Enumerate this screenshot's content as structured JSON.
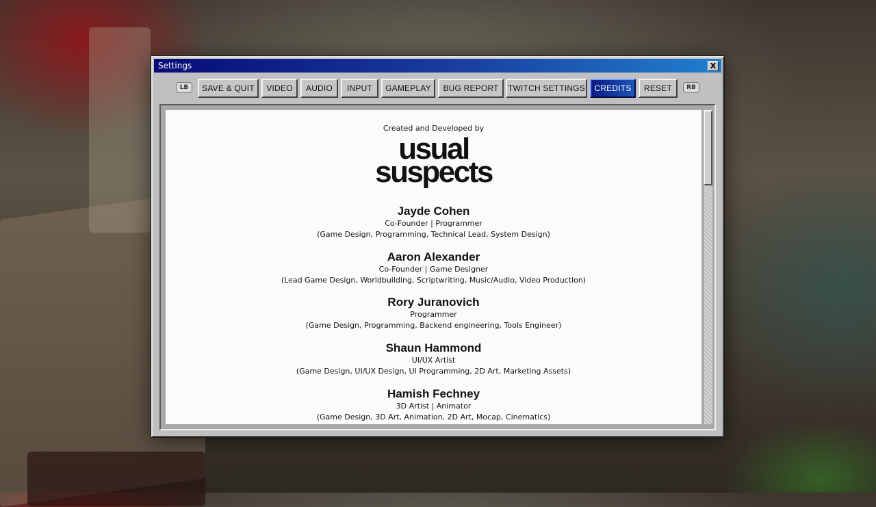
{
  "window": {
    "title": "Settings",
    "close_label": "X"
  },
  "tabs": {
    "lb_label": "LB",
    "rb_label": "RB",
    "items": [
      {
        "label": "SAVE & QUIT"
      },
      {
        "label": "VIDEO"
      },
      {
        "label": "AUDIO"
      },
      {
        "label": "INPUT"
      },
      {
        "label": "GAMEPLAY"
      },
      {
        "label": "BUG REPORT"
      },
      {
        "label": "TWITCH SETTINGS"
      },
      {
        "label": "CREDITS",
        "active": true
      },
      {
        "label": "RESET"
      }
    ]
  },
  "credits": {
    "intro": "Created and Developed by",
    "studio_logo_line1": "usual",
    "studio_logo_line2": "suspects",
    "people": [
      {
        "name": "Jayde Cohen",
        "role": "Co-Founder | Programmer",
        "details": "(Game Design, Programming, Technical Lead, System Design)"
      },
      {
        "name": "Aaron Alexander",
        "role": "Co-Founder | Game Designer",
        "details": "(Lead Game Design, Worldbuilding, Scriptwriting, Music/Audio, Video Production)"
      },
      {
        "name": "Rory Juranovich",
        "role": "Programmer",
        "details": "(Game Design, Programming, Backend engineering, Tools Engineer)"
      },
      {
        "name": "Shaun Hammond",
        "role": "UI/UX Artist",
        "details": "(Game Design, UI/UX Design, UI Programming, 2D Art, Marketing Assets)"
      },
      {
        "name": "Hamish Fechney",
        "role": "3D Artist | Animator",
        "details": "(Game Design, 3D Art, Animation, 2D Art, Mocap, Cinematics)"
      }
    ]
  },
  "colors": {
    "titlebar_start": "#070b78",
    "titlebar_end": "#1f7fcf",
    "active_tab": "#0b1a86",
    "panel_bg": "#fbfbfb",
    "window_gray": "#c0c0c0"
  }
}
